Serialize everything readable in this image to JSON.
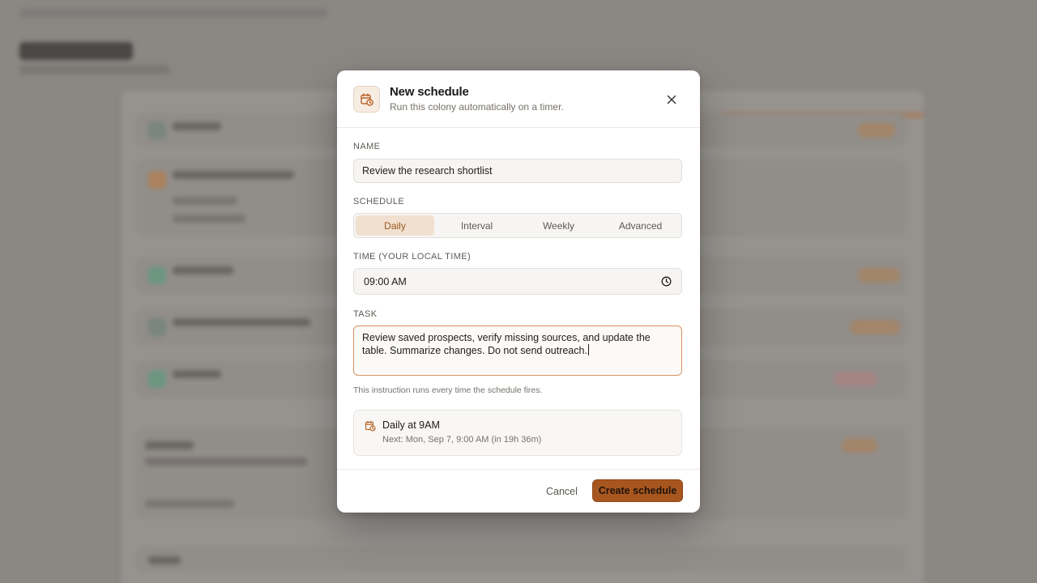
{
  "dialog": {
    "title": "New schedule",
    "subtitle": "Run this colony automatically on a timer.",
    "icon": "calendar-clock-icon",
    "close_icon": "close-icon"
  },
  "form": {
    "name": {
      "label": "NAME",
      "value": "Review the research shortlist"
    },
    "schedule": {
      "label": "SCHEDULE",
      "options": [
        "Daily",
        "Interval",
        "Weekly",
        "Advanced"
      ],
      "selected": "Daily"
    },
    "time": {
      "label": "TIME (YOUR LOCAL TIME)",
      "value": "09:00 AM",
      "icon": "clock-icon"
    },
    "task": {
      "label": "TASK",
      "value": "Review saved prospects, verify missing sources, and update the table. Summarize changes. Do not send outreach.",
      "helper": "This instruction runs every time the schedule fires."
    },
    "summary": {
      "title": "Daily at 9AM",
      "next_run": "Next: Mon, Sep 7, 9:00 AM (in 19h 36m)",
      "icon": "calendar-clock-icon"
    }
  },
  "footer": {
    "cancel_label": "Cancel",
    "create_label": "Create schedule"
  },
  "colors": {
    "accent": "#a8561f",
    "accent_soft": "#f1e0cf",
    "accent_text": "#9a561f"
  }
}
